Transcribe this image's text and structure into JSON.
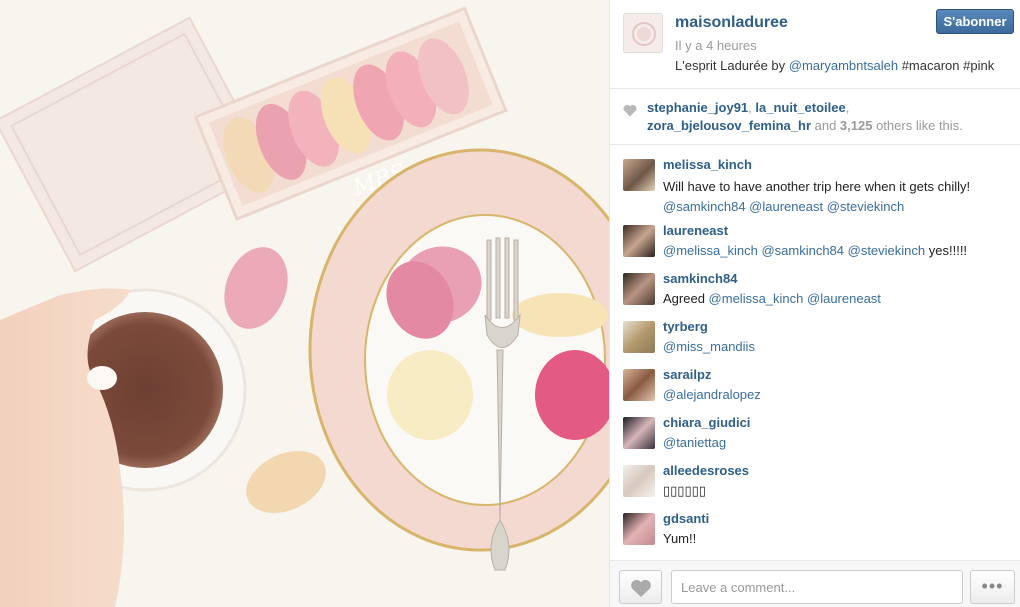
{
  "post": {
    "owner": "maisonladuree",
    "time": "Il y a 4 heures",
    "caption_text": "L'esprit Ladurée by ",
    "caption_mention": "@maryambntsaleh",
    "caption_tags": " #macaron #pink",
    "follow_label": "S'abonner",
    "watermark": "MBS."
  },
  "likes": {
    "user1": "stephanie_joy91",
    "sep1": ", ",
    "user2": "la_nuit_etoilee",
    "sep2": ",",
    "user3": "zora_bjelousov_femina_hr",
    "and_text": " and ",
    "count": "3,125",
    "suffix": " others like this."
  },
  "comments": [
    {
      "user": "melissa_kinch",
      "text": "Will have to have another trip here when it gets chilly!",
      "mentions": "@samkinch84 @laureneast @steviekinch",
      "tail": ""
    },
    {
      "user": "laureneast",
      "text": "",
      "mentions": "@melissa_kinch @samkinch84 @steviekinch",
      "tail": " yes!!!!!"
    },
    {
      "user": "samkinch84",
      "text": "Agreed ",
      "mentions": "@melissa_kinch @laureneast",
      "tail": ""
    },
    {
      "user": "tyrberg",
      "text": "",
      "mentions": "@miss_mandiis",
      "tail": ""
    },
    {
      "user": "sarailpz",
      "text": "",
      "mentions": "@alejandralopez",
      "tail": ""
    },
    {
      "user": "chiara_giudici",
      "text": "",
      "mentions": "@taniettag",
      "tail": ""
    },
    {
      "user": "alleedesroses",
      "text": "▯▯▯▯▯▯",
      "mentions": "",
      "tail": ""
    },
    {
      "user": "gdsanti",
      "text": "Yum!!",
      "mentions": "",
      "tail": ""
    }
  ],
  "footer": {
    "comment_placeholder": "Leave a comment...",
    "more_label": "•••"
  },
  "icons": {
    "heart": "heart-icon",
    "more": "more-options-icon"
  },
  "colors": {
    "username": "#2d5f87",
    "link": "#3a6e9b",
    "follow_button": "#3c6b9c"
  }
}
